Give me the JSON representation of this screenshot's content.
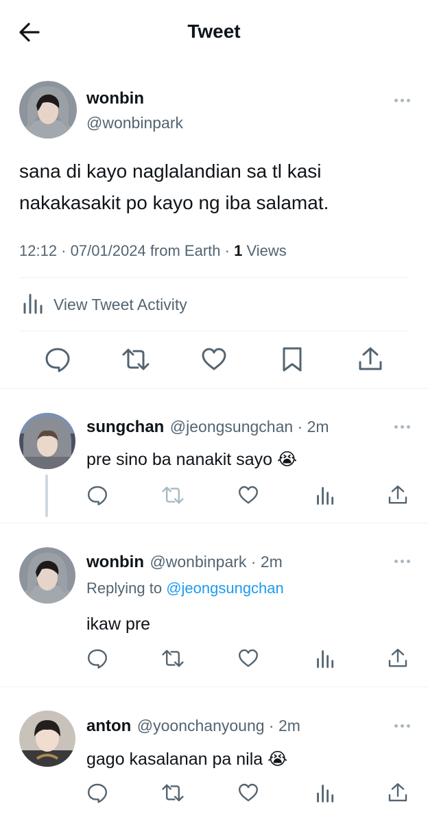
{
  "header": {
    "title": "Tweet",
    "back_icon": "arrow-left-icon"
  },
  "tweet": {
    "author_name": "wonbin",
    "author_handle": "@wonbinpark",
    "text_line1": "sana di kayo naglalandian sa tl kasi",
    "text_line2": "nakakasakit po kayo ng iba salamat.",
    "meta_prefix": "12:12 · 07/01/2024 from Earth · ",
    "views_count": "1",
    "views_label": " Views",
    "activity_label": "View Tweet Activity"
  },
  "replies": [
    {
      "name": "sungchan",
      "handle": "@jeongsungchan",
      "time": " · 2m",
      "text": "pre sino ba nanakit sayo 😭"
    },
    {
      "name": "wonbin",
      "handle": "@wonbinpark",
      "time": " · 2m",
      "replying_prefix": "Replying to ",
      "replying_to": "@jeongsungchan",
      "text": "ikaw pre"
    },
    {
      "name": "anton",
      "handle": "@yoonchanyoung",
      "time": " · 2m",
      "text": "gago kasalanan pa nila 😭"
    }
  ],
  "colors": {
    "link": "#1d9bf0",
    "muted": "#536471",
    "divider": "#eff3f4"
  }
}
